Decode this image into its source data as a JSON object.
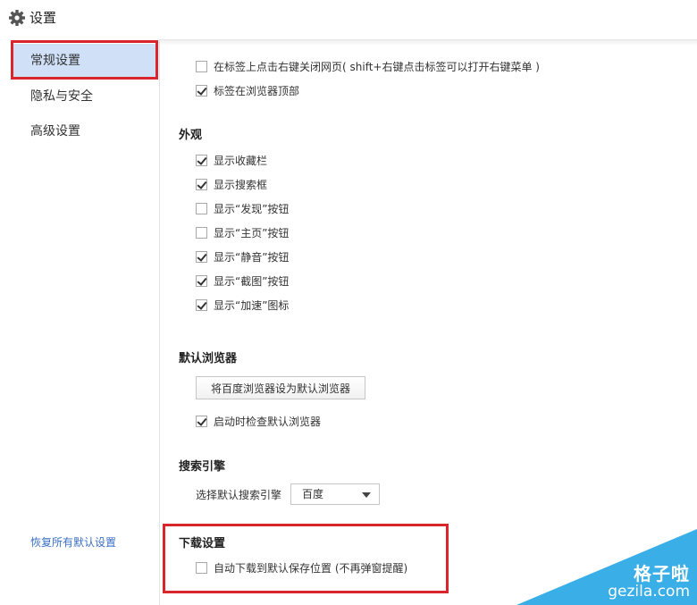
{
  "header": {
    "title": "设置",
    "icon": "gear-icon"
  },
  "sidebar": {
    "items": [
      {
        "label": "常规设置",
        "active": true
      },
      {
        "label": "隐私与安全",
        "active": false
      },
      {
        "label": "高级设置",
        "active": false
      }
    ],
    "restore_link": "恢复所有默认设置"
  },
  "tabs_section": {
    "items": [
      {
        "label": "在标签上点击右键关闭网页( shift+右键点击标签可以打开右键菜单 )",
        "checked": false
      },
      {
        "label": "标签在浏览器顶部",
        "checked": true
      }
    ]
  },
  "appearance": {
    "title": "外观",
    "items": [
      {
        "label": "显示收藏栏",
        "checked": true
      },
      {
        "label": "显示搜索框",
        "checked": true
      },
      {
        "label": "显示“发现”按钮",
        "checked": false
      },
      {
        "label": "显示“主页”按钮",
        "checked": false
      },
      {
        "label": "显示“静音”按钮",
        "checked": true
      },
      {
        "label": "显示“截图”按钮",
        "checked": true
      },
      {
        "label": "显示“加速”图标",
        "checked": true
      }
    ]
  },
  "default_browser": {
    "title": "默认浏览器",
    "button_label": "将百度浏览器设为默认浏览器",
    "check_label": "启动时检查默认浏览器",
    "checked": true
  },
  "search_engine": {
    "title": "搜索引擎",
    "select_label": "选择默认搜索引擎",
    "selected": "百度"
  },
  "download": {
    "title": "下载设置",
    "check_label": "自动下载到默认保存位置 (不再弹窗提醒)",
    "checked": false
  },
  "watermark": {
    "line1": "格子啦",
    "line2": "gezila.com",
    "color": "#3aaee6"
  },
  "colors": {
    "highlight": "#d9262c",
    "active_nav": "#cfe0f7",
    "link": "#3a6fc4"
  }
}
